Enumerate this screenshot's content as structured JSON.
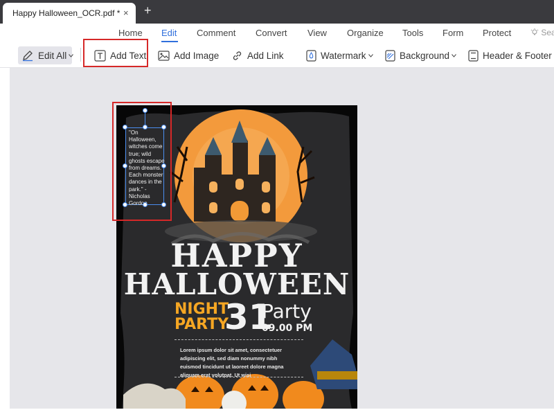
{
  "tab": {
    "title": "Happy Halloween_OCR.pdf *",
    "close": "×",
    "new": "+"
  },
  "menu": {
    "items": [
      "Home",
      "Edit",
      "Comment",
      "Convert",
      "View",
      "Organize",
      "Tools",
      "Form",
      "Protect"
    ],
    "active": "Edit",
    "search_hint": "Sea"
  },
  "toolbar": {
    "edit_all": "Edit All",
    "add_text": "Add Text",
    "add_image": "Add Image",
    "add_link": "Add Link",
    "watermark": "Watermark",
    "background": "Background",
    "header_footer": "Header & Footer"
  },
  "poster": {
    "title_line1": "HAPPY",
    "title_line2": "HALLOWEEN",
    "night": "NIGHT",
    "party_sub": "PARTY",
    "day": "31",
    "party_label": "Party",
    "time": "09.00 PM",
    "body_text": "Lorem ipsum dolor sit amet, consectetuer adipiscing elit, sed diam nonummy nibh euismod tincidunt ut laoreet dolore magna aliquam erat volutpat. Ut wisi",
    "quote": "\"On Halloween, witches come true; wild ghosts escape from dreams. Each monster dances in the park.\" - Nicholas Gordon"
  },
  "colors": {
    "accent": "#2f6fdc",
    "highlight": "#d62828",
    "orange": "#f5a623",
    "moon": "#f39a3c"
  }
}
